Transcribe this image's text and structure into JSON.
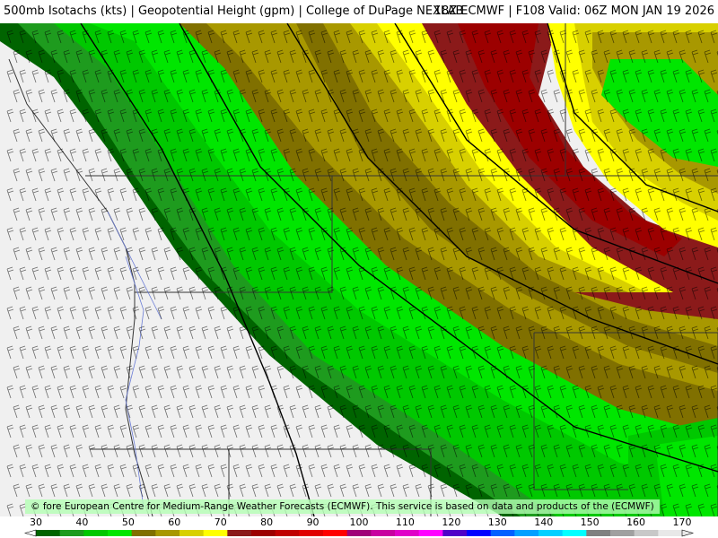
{
  "header": {
    "left": "500mb Isotachs (kts) | Geopotential Height (gpm) | College of DuPage NEXLAB",
    "right": "18Z ECMWF | F108 Valid: 06Z MON JAN 19 2026"
  },
  "credit": "© fore European Centre for Medium-Range Weather Forecasts (ECMWF). This service is based on data and products of the (ECMWF)",
  "legend": {
    "labels": [
      "30",
      "40",
      "50",
      "60",
      "70",
      "80",
      "90",
      "100",
      "110",
      "120",
      "130",
      "140",
      "150",
      "160",
      "170"
    ],
    "colors": [
      "#006400",
      "#1e9b1e",
      "#00c800",
      "#00e600",
      "#807000",
      "#a89800",
      "#d8d000",
      "#ffff00",
      "#8b1a1a",
      "#9c0000",
      "#c00000",
      "#e00000",
      "#ff0000",
      "#a00078",
      "#c800a0",
      "#e000c8",
      "#ff00ff",
      "#5000c8",
      "#0000ff",
      "#0060ff",
      "#00a0ff",
      "#00d0ff",
      "#00ffff",
      "#808080",
      "#a0a0a0",
      "#c8c8c8",
      "#e8e8e8"
    ]
  },
  "map": {
    "speed_colors": {
      "light_green": "#00e600",
      "green": "#00c800",
      "dark_green": "#1e9b1e",
      "darkest_green": "#006400",
      "olive": "#807000",
      "khaki": "#a89800",
      "yellow_olive": "#d8d000",
      "yellow": "#ffff00",
      "dark_red": "#8b1a1a",
      "red": "#9c0000"
    },
    "land_color": "#f0f0f0"
  }
}
